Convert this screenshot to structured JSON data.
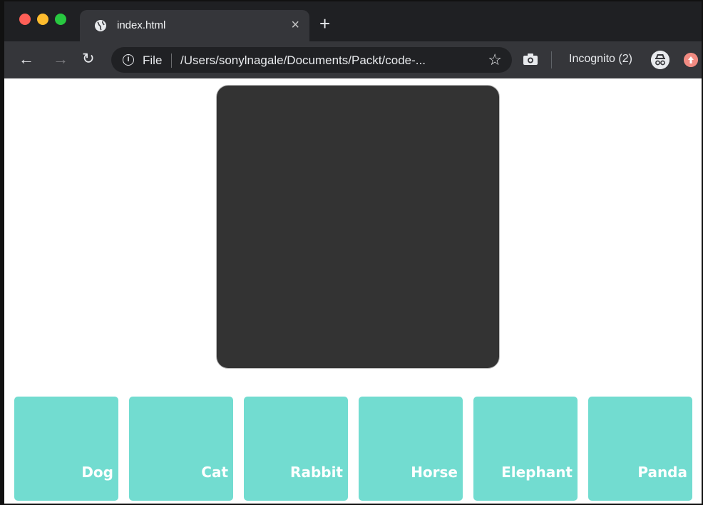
{
  "browser": {
    "tab": {
      "title": "index.html",
      "icon": "globe-icon"
    },
    "toolbar": {
      "scheme_label": "File",
      "url": "/Users/sonylnagale/Documents/Packt/code-...",
      "incognito_label": "Incognito (2)"
    }
  },
  "page": {
    "display": {
      "color": "#333333"
    },
    "cards": [
      {
        "label": "Dog"
      },
      {
        "label": "Cat"
      },
      {
        "label": "Rabbit"
      },
      {
        "label": "Horse"
      },
      {
        "label": "Elephant"
      },
      {
        "label": "Panda"
      }
    ],
    "colors": {
      "card": "#72dcd0",
      "card_text": "#ffffff"
    }
  }
}
